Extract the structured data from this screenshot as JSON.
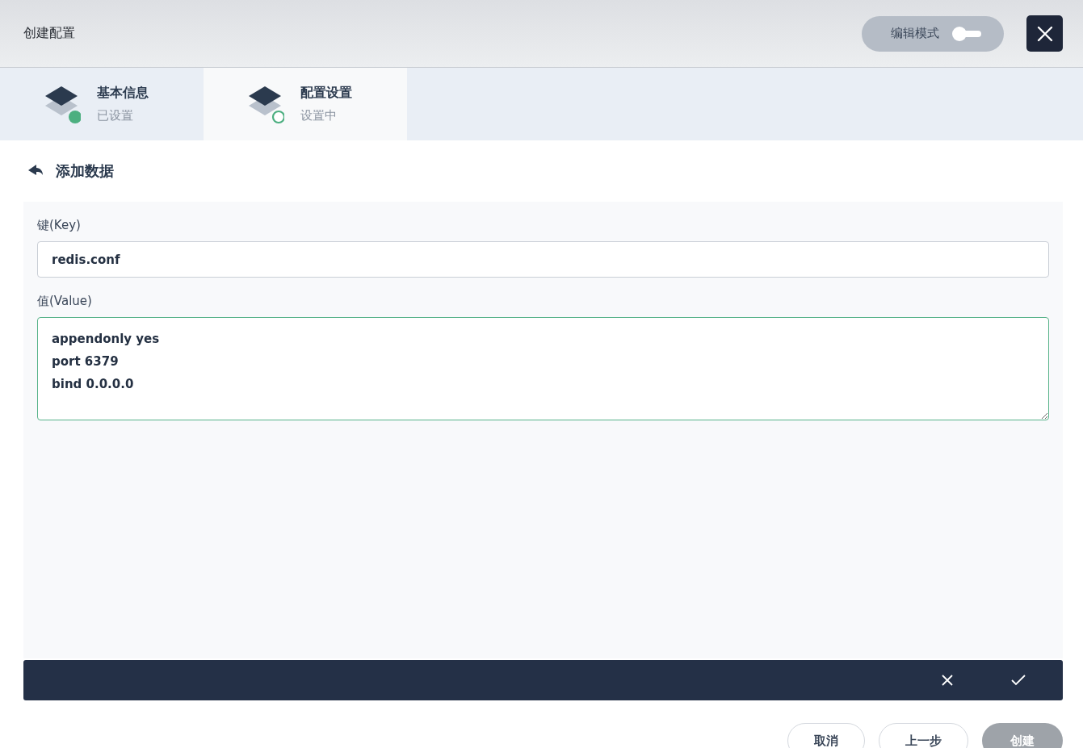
{
  "window": {
    "title": "创建配置"
  },
  "edit_mode": {
    "label": "编辑模式",
    "on": false
  },
  "steps": [
    {
      "title": "基本信息",
      "status_text": "已设置",
      "done": true,
      "selected": false
    },
    {
      "title": "配置设置",
      "status_text": "设置中",
      "done": false,
      "selected": true
    }
  ],
  "section": {
    "title": "添加数据"
  },
  "fields": [
    {
      "label": "键(Key)",
      "value": "redis.conf",
      "kind": "input",
      "focused": false
    },
    {
      "label": "值(Value)",
      "value": "appendonly yes\nport 6379\nbind 0.0.0.0",
      "kind": "textarea",
      "focused": true
    }
  ],
  "footer_buttons": [
    {
      "label": "取消",
      "kind": "secondary",
      "disabled": false
    },
    {
      "label": "上一步",
      "kind": "secondary",
      "disabled": false
    },
    {
      "label": "创建",
      "kind": "primary",
      "disabled": true
    }
  ]
}
